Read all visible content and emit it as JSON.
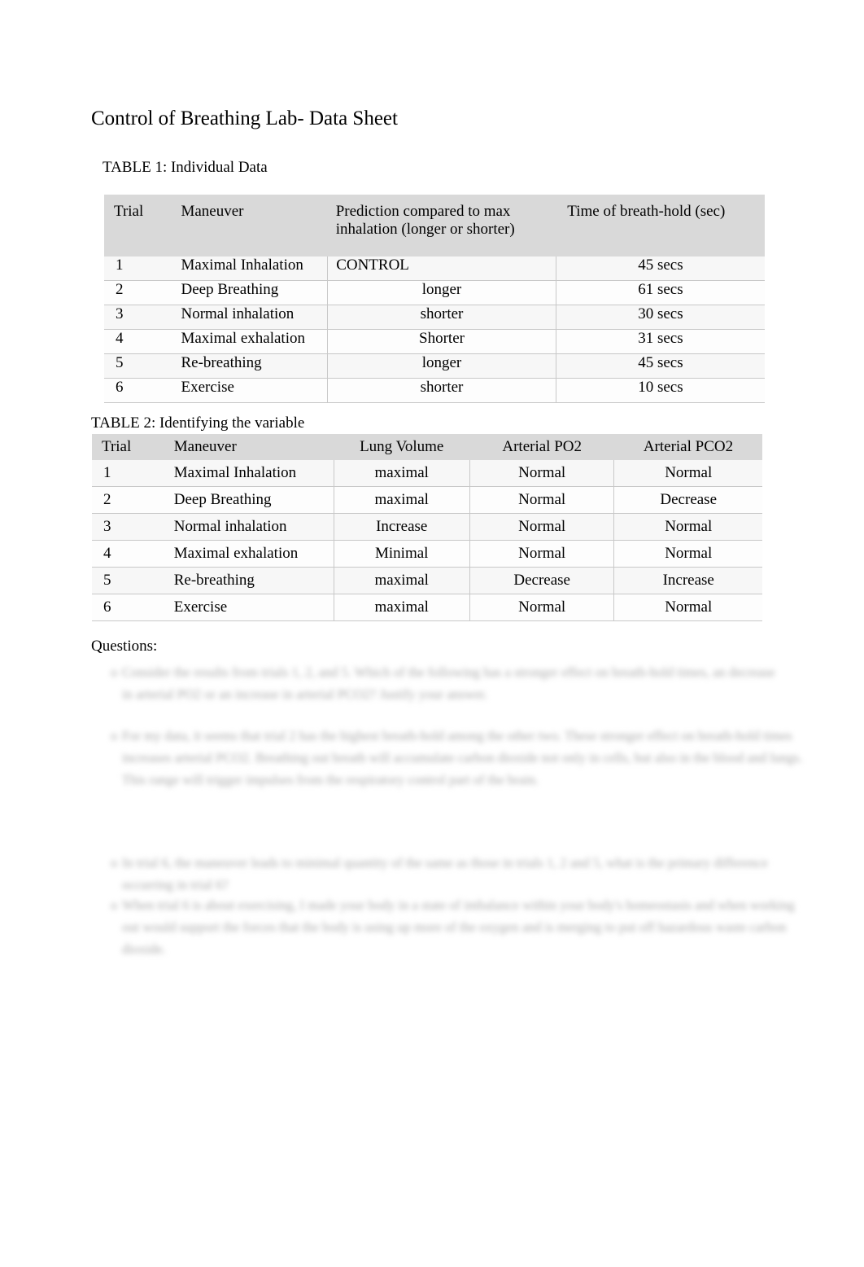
{
  "document": {
    "title": "Control of Breathing Lab- Data Sheet",
    "questions_label": "Questions:"
  },
  "table1": {
    "caption": "TABLE 1: Individual Data",
    "headers": [
      "Trial",
      "Maneuver",
      "Prediction compared to max inhalation (longer or shorter)",
      "Time of breath-hold (sec)"
    ],
    "header_line1": "Prediction compared to max",
    "header_line2": "inhalation (longer or shorter)",
    "rows": [
      {
        "trial": "1",
        "maneuver": "Maximal Inhalation",
        "prediction": "CONTROL",
        "time": "45 secs"
      },
      {
        "trial": "2",
        "maneuver": "Deep Breathing",
        "prediction": "longer",
        "time": "61 secs"
      },
      {
        "trial": "3",
        "maneuver": "Normal inhalation",
        "prediction": "shorter",
        "time": "30 secs"
      },
      {
        "trial": "4",
        "maneuver": "Maximal exhalation",
        "prediction": "Shorter",
        "time": "31 secs"
      },
      {
        "trial": "5",
        "maneuver": "Re-breathing",
        "prediction": "longer",
        "time": "45 secs"
      },
      {
        "trial": "6",
        "maneuver": "Exercise",
        "prediction": "shorter",
        "time": "10 secs"
      }
    ]
  },
  "table2": {
    "caption": "TABLE 2: Identifying the variable",
    "headers": [
      "Trial",
      "Maneuver",
      "Lung Volume",
      "Arterial PO2",
      "Arterial PCO2"
    ],
    "rows": [
      {
        "trial": "1",
        "maneuver": "Maximal Inhalation",
        "lung_volume": "maximal",
        "po2": "Normal",
        "pco2": "Normal"
      },
      {
        "trial": "2",
        "maneuver": "Deep Breathing",
        "lung_volume": "maximal",
        "po2": "Normal",
        "pco2": "Decrease"
      },
      {
        "trial": "3",
        "maneuver": "Normal inhalation",
        "lung_volume": "Increase",
        "po2": "Normal",
        "pco2": "Normal"
      },
      {
        "trial": "4",
        "maneuver": "Maximal exhalation",
        "lung_volume": "Minimal",
        "po2": "Normal",
        "pco2": "Normal"
      },
      {
        "trial": "5",
        "maneuver": "Re-breathing",
        "lung_volume": "maximal",
        "po2": "Decrease",
        "pco2": "Increase"
      },
      {
        "trial": "6",
        "maneuver": "Exercise",
        "lung_volume": "maximal",
        "po2": "Normal",
        "pco2": "Normal"
      }
    ]
  },
  "answers": {
    "question1": "Consider the results from trials 1, 2, and 5. Which of the following has a stronger effect on breath-hold times, an decrease in arterial PO2 or an increase in arterial PCO2? Justify your answer.",
    "answer1": "For my data, it seems that trial 2 has the highest breath-hold among the other two. These stronger effect on breath-hold times increases arterial PCO2. Breathing out breath will accumulate carbon dioxide not only in cells, but also in the blood and lungs. This range will trigger impulses from the respiratory control part of the brain.",
    "question2": "In trial 6, the maneuver leads to minimal quantity of the same as those in trials 1, 2 and 5, what is the primary difference occurring in trial 6?",
    "answer2": "When trial 6 is about exercising, I made your body in a state of imbalance within your body's homeostasis and when working out would support the forces that the body is using up more of the oxygen and is merging to put off hazardous waste carbon dioxide."
  }
}
